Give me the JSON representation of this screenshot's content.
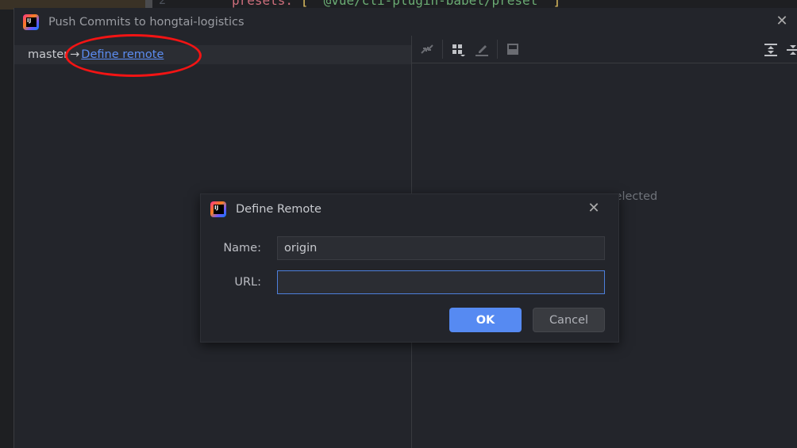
{
  "editor": {
    "line_number": "2",
    "code_key": "presets: ",
    "code_open": "[ ",
    "code_string": "'@vue/cli-plugin-babel/preset'",
    "code_close": " ]"
  },
  "push_dialog": {
    "title": "Push Commits to hongtai-logistics",
    "branch": "master",
    "arrow": "→",
    "define_remote_link": "Define remote",
    "empty_text": "selected",
    "toolbar": [
      "collapse-icon",
      "group-by-icon",
      "edit-icon",
      "preview-icon",
      "expand-all-icon",
      "collapse-all-icon"
    ],
    "annotation_color": "#f21414"
  },
  "define_remote_dialog": {
    "title": "Define Remote",
    "name_label": "Name:",
    "name_value": "origin",
    "url_label": "URL:",
    "url_value": "",
    "ok_label": "OK",
    "cancel_label": "Cancel",
    "accent": "#568af2"
  }
}
